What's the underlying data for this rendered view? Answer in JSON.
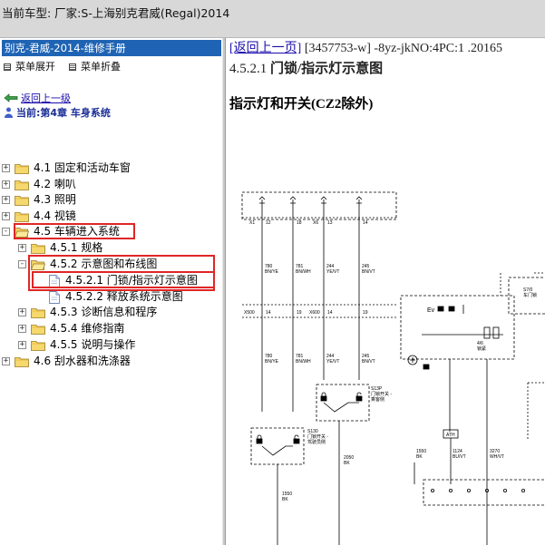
{
  "titlebar": {
    "text": "当前车型:   厂家:S-上海别克君威(Regal)2014"
  },
  "sidebar": {
    "header": "别克-君威-2014-维修手册",
    "expand_all": "菜单展开",
    "collapse_all": "菜单折叠",
    "back_label": "返回上一级",
    "current_label": "当前:第4章  车身系统",
    "tree": [
      {
        "label": "4.1 固定和活动车窗"
      },
      {
        "label": "4.2 喇叭"
      },
      {
        "label": "4.3 照明"
      },
      {
        "label": "4.4 视镜"
      },
      {
        "label": "4.5 车辆进入系统"
      },
      {
        "label": "4.5.1 规格"
      },
      {
        "label": "4.5.2 示意图和布线图"
      },
      {
        "label": "4.5.2.1 门锁/指示灯示意图"
      },
      {
        "label": "4.5.2.2 释放系统示意图"
      },
      {
        "label": "4.5.3 诊断信息和程序"
      },
      {
        "label": "4.5.4 维修指南"
      },
      {
        "label": "4.5.5 说明与操作"
      },
      {
        "label": "4.6 刮水器和洗涤器"
      }
    ]
  },
  "content": {
    "back_link": "[返回上一页]",
    "doc_meta": " [3457753-w] -8yz-jkNO:4PC:1 .20165",
    "section_number": "4.5.2.1",
    "section_title": "门锁/指示灯示意图",
    "figure_title": "指示灯和开关(CZ2除外)"
  },
  "diagram": {
    "connectors_top": [
      "X1",
      "12",
      "18",
      "X6",
      "13",
      "14"
    ],
    "wires_top": [
      {
        "num": "780",
        "color": "BN/YE"
      },
      {
        "num": "781",
        "color": "BN/WH"
      },
      {
        "num": "244",
        "color": "YE/VT"
      },
      {
        "num": "245",
        "color": "BN/VT"
      }
    ],
    "connectors_mid": [
      "X500",
      "14",
      "19",
      "X600",
      "14",
      "19"
    ],
    "s130": "S130\n门锁开关 -\n驾驶员侧",
    "s13p": "S13P\n门锁开关 -\n乘客侧",
    "wire_1550": {
      "num": "1550",
      "color": "BK"
    },
    "wire_2050": {
      "num": "2050",
      "color": "BK"
    },
    "wire_1124": {
      "num": "1124",
      "color": "BU/VT"
    },
    "wire_3270": {
      "num": "3270",
      "color": "WH/VT"
    },
    "ath": "ATH",
    "s7": {
      "id": "S7/0",
      "name": "车门锁模块"
    }
  }
}
